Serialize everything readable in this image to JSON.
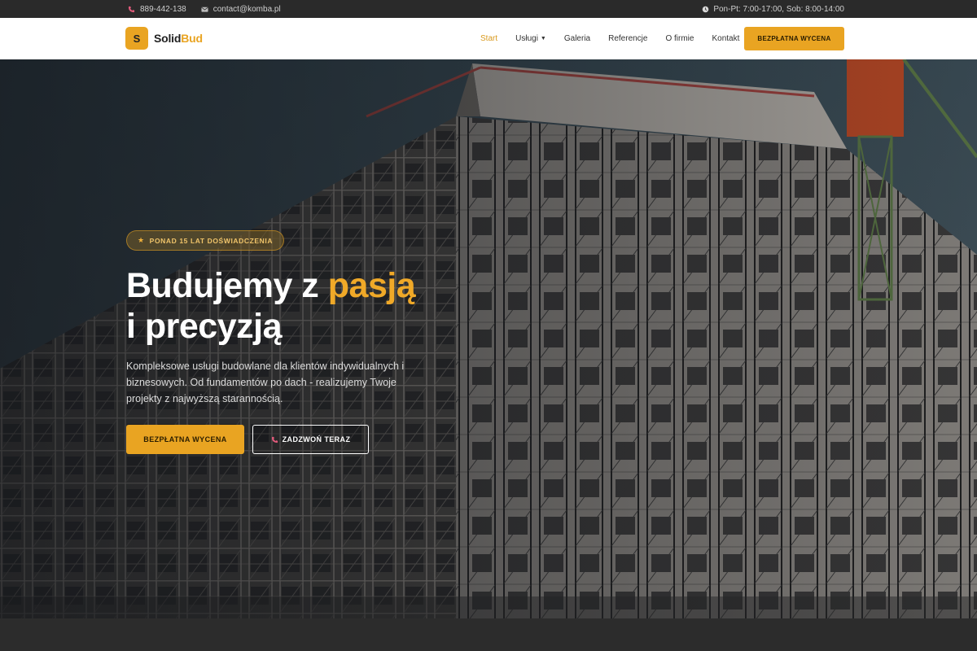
{
  "topbar": {
    "phone": "889-442-138",
    "email": "contact@komba.pl",
    "hours": "Pon-Pt: 7:00-17:00, Sob: 8:00-14:00"
  },
  "header": {
    "logo_letter": "S",
    "logo_name_main": "Solid",
    "logo_name_accent": "Bud",
    "nav": [
      {
        "label": "Start",
        "active": true
      },
      {
        "label": "Usługi",
        "dropdown": true
      },
      {
        "label": "Galeria"
      },
      {
        "label": "Referencje"
      },
      {
        "label": "O firmie"
      },
      {
        "label": "Kontakt"
      }
    ],
    "cta_label": "BEZPŁATNA WYCENA"
  },
  "hero": {
    "badge": "PONAD 15 LAT DOŚWIADCZENIA",
    "title_line1_a": "Budujemy z ",
    "title_line1_accent": "pasją",
    "title_line2": "i precyzją",
    "description": "Kompleksowe usługi budowlane dla klientów indywidualnych i biznesowych. Od fundamentów po dach - realizujemy Twoje projekty z najwyższą starannością.",
    "btn_primary": "BEZPŁATNA WYCENA",
    "btn_secondary": "ZADZWOŃ TERAZ"
  },
  "colors": {
    "accent": "#e9a422",
    "topbar_bg": "#2a2a2a",
    "header_bg": "#ffffff",
    "phone_icon": "#e05a7a"
  },
  "icons": {
    "phone": "phone-icon",
    "email": "email-icon",
    "clock": "clock-icon",
    "star": "star-icon"
  }
}
